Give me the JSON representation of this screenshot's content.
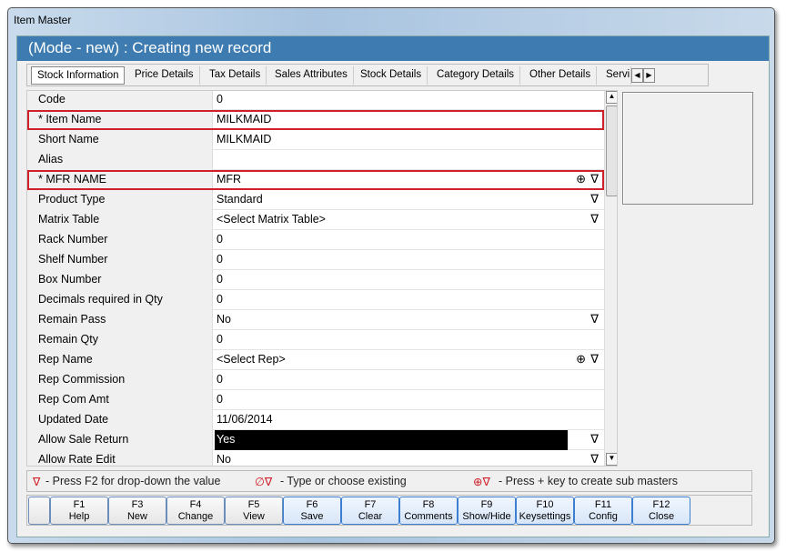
{
  "window": {
    "title": "Item Master"
  },
  "header": {
    "title": "(Mode - new) : Creating new record"
  },
  "tabs": [
    "Stock Information",
    "Price Details",
    "Tax Details",
    "Sales Attributes",
    "Stock Details",
    "Category Details",
    "Other Details",
    "Servi"
  ],
  "fields": [
    {
      "label": "Code",
      "value": "0"
    },
    {
      "label": "* Item Name",
      "value": "MILKMAID",
      "required": true
    },
    {
      "label": "Short Name",
      "value": "MILKMAID"
    },
    {
      "label": "Alias",
      "value": ""
    },
    {
      "label": "* MFR NAME",
      "value": "MFR",
      "required": true,
      "dropdown": true,
      "plus": true
    },
    {
      "label": "Product Type",
      "value": "Standard",
      "dropdown": true
    },
    {
      "label": "Matrix Table",
      "value": "<Select Matrix Table>",
      "dropdown": true
    },
    {
      "label": "Rack Number",
      "value": "0"
    },
    {
      "label": "Shelf Number",
      "value": "0"
    },
    {
      "label": "Box Number",
      "value": "0"
    },
    {
      "label": "Decimals required in Qty",
      "value": "0"
    },
    {
      "label": "Remain Pass",
      "value": "No",
      "dropdown": true
    },
    {
      "label": "Remain Qty",
      "value": "0"
    },
    {
      "label": "Rep Name",
      "value": "<Select Rep>",
      "dropdown": true,
      "plus": true
    },
    {
      "label": "Rep Commission",
      "value": "0"
    },
    {
      "label": "Rep Com Amt",
      "value": "0"
    },
    {
      "label": "Updated Date",
      "value": "11/06/2014"
    },
    {
      "label": "Allow Sale Return",
      "value": "Yes",
      "dropdown": true,
      "selected": true
    },
    {
      "label": "Allow Rate Edit",
      "value": "No",
      "dropdown": true
    }
  ],
  "legend": {
    "dropdown_icon": "∇",
    "dropdown_text": "- Press F2 for drop-down the value",
    "type_icon": "∅∇",
    "type_text": "- Type or choose existing",
    "plus_icon": "⊕∇",
    "plus_text": "- Press + key to create sub masters"
  },
  "buttons": [
    {
      "key": "F1",
      "label": "Help"
    },
    {
      "key": "F3",
      "label": "New"
    },
    {
      "key": "F4",
      "label": "Change"
    },
    {
      "key": "F5",
      "label": "View"
    },
    {
      "key": "F6",
      "label": "Save"
    },
    {
      "key": "F7",
      "label": "Clear"
    },
    {
      "key": "F8",
      "label": "Comments"
    },
    {
      "key": "F9",
      "label": "Show/Hide"
    },
    {
      "key": "F10",
      "label": "Keysettings"
    },
    {
      "key": "F11",
      "label": "Config"
    },
    {
      "key": "F12",
      "label": "Close"
    }
  ]
}
